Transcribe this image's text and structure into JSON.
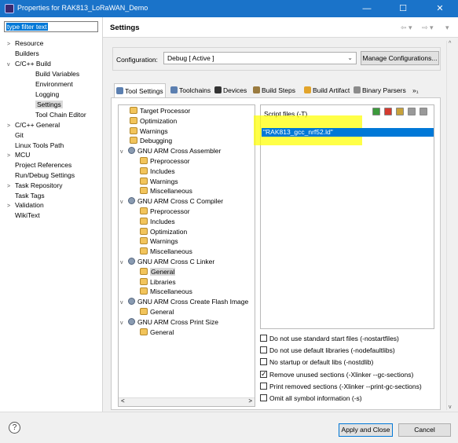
{
  "window": {
    "title": "Properties for RAK813_LoRaWAN_Demo",
    "min": "—",
    "max": "☐",
    "close": "✕"
  },
  "filter": {
    "value": "type filter text"
  },
  "nav_tree": [
    {
      "label": "Resource",
      "twist": ">",
      "depth": 0
    },
    {
      "label": "Builders",
      "twist": "",
      "depth": 0
    },
    {
      "label": "C/C++ Build",
      "twist": "v",
      "depth": 0
    },
    {
      "label": "Build Variables",
      "twist": "",
      "depth": 1
    },
    {
      "label": "Environment",
      "twist": "",
      "depth": 1
    },
    {
      "label": "Logging",
      "twist": "",
      "depth": 1
    },
    {
      "label": "Settings",
      "twist": "",
      "depth": 1,
      "selected": true
    },
    {
      "label": "Tool Chain Editor",
      "twist": "",
      "depth": 1
    },
    {
      "label": "C/C++ General",
      "twist": ">",
      "depth": 0
    },
    {
      "label": "Git",
      "twist": "",
      "depth": 0
    },
    {
      "label": "Linux Tools Path",
      "twist": "",
      "depth": 0
    },
    {
      "label": "MCU",
      "twist": ">",
      "depth": 0
    },
    {
      "label": "Project References",
      "twist": "",
      "depth": 0
    },
    {
      "label": "Run/Debug Settings",
      "twist": "",
      "depth": 0
    },
    {
      "label": "Task Repository",
      "twist": ">",
      "depth": 0
    },
    {
      "label": "Task Tags",
      "twist": "",
      "depth": 0
    },
    {
      "label": "Validation",
      "twist": ">",
      "depth": 0
    },
    {
      "label": "WikiText",
      "twist": "",
      "depth": 0
    }
  ],
  "settings": {
    "title": "Settings",
    "back": "⇦ ▾",
    "fwd": "⇨ ▾",
    "menu": "▾",
    "config_label": "Configuration:",
    "config_value": "Debug  [ Active ]",
    "manage_label": "Manage Configurations..."
  },
  "tabs": [
    {
      "label": "Tool Settings",
      "icon_color": "#5b7fb0",
      "active": true
    },
    {
      "label": "Toolchains",
      "icon_color": "#5b7fb0"
    },
    {
      "label": "Devices",
      "icon_color": "#333333"
    },
    {
      "label": "Build Steps",
      "icon_color": "#9a7b3f"
    },
    {
      "label": "Build Artifact",
      "icon_color": "#e2a42b"
    },
    {
      "label": "Binary Parsers",
      "icon_color": "#8b8b8b"
    },
    {
      "label": "»₁",
      "icon_color": ""
    }
  ],
  "tool_tree": [
    {
      "label": "Target Processor",
      "twist": "",
      "icon": "t",
      "depth": 1
    },
    {
      "label": "Optimization",
      "twist": "",
      "icon": "t",
      "depth": 1
    },
    {
      "label": "Warnings",
      "twist": "",
      "icon": "t",
      "depth": 1
    },
    {
      "label": "Debugging",
      "twist": "",
      "icon": "t",
      "depth": 1
    },
    {
      "label": "GNU ARM Cross Assembler",
      "twist": "v",
      "icon": "g",
      "depth": 0
    },
    {
      "label": "Preprocessor",
      "twist": "",
      "icon": "t",
      "depth": 2
    },
    {
      "label": "Includes",
      "twist": "",
      "icon": "t",
      "depth": 2
    },
    {
      "label": "Warnings",
      "twist": "",
      "icon": "t",
      "depth": 2
    },
    {
      "label": "Miscellaneous",
      "twist": "",
      "icon": "t",
      "depth": 2
    },
    {
      "label": "GNU ARM Cross C Compiler",
      "twist": "v",
      "icon": "g",
      "depth": 0
    },
    {
      "label": "Preprocessor",
      "twist": "",
      "icon": "t",
      "depth": 2
    },
    {
      "label": "Includes",
      "twist": "",
      "icon": "t",
      "depth": 2
    },
    {
      "label": "Optimization",
      "twist": "",
      "icon": "t",
      "depth": 2
    },
    {
      "label": "Warnings",
      "twist": "",
      "icon": "t",
      "depth": 2
    },
    {
      "label": "Miscellaneous",
      "twist": "",
      "icon": "t",
      "depth": 2
    },
    {
      "label": "GNU ARM Cross C Linker",
      "twist": "v",
      "icon": "g",
      "depth": 0
    },
    {
      "label": "General",
      "twist": "",
      "icon": "t",
      "depth": 2,
      "selected": true
    },
    {
      "label": "Libraries",
      "twist": "",
      "icon": "t",
      "depth": 2
    },
    {
      "label": "Miscellaneous",
      "twist": "",
      "icon": "t",
      "depth": 2
    },
    {
      "label": "GNU ARM Cross Create Flash Image",
      "twist": "v",
      "icon": "g",
      "depth": 0
    },
    {
      "label": "General",
      "twist": "",
      "icon": "t",
      "depth": 2
    },
    {
      "label": "GNU ARM Cross Print Size",
      "twist": "v",
      "icon": "g",
      "depth": 0
    },
    {
      "label": "General",
      "twist": "",
      "icon": "t",
      "depth": 2
    }
  ],
  "scroll": {
    "left": "<",
    "right": ">",
    "up": "^",
    "down": "v"
  },
  "script": {
    "label": "Script files (-T)",
    "value": "\"RAK813_gcc_nrf52.ld\"",
    "tool_icons": [
      {
        "name": "add-file-icon",
        "color": "#3c9a3c"
      },
      {
        "name": "delete-file-icon",
        "color": "#d43a2f"
      },
      {
        "name": "edit-file-icon",
        "color": "#c8a23a"
      },
      {
        "name": "move-up-icon",
        "color": "#999999"
      },
      {
        "name": "move-down-icon",
        "color": "#999999"
      }
    ]
  },
  "options": [
    {
      "label": "Do not use standard start files (-nostartfiles)",
      "checked": false
    },
    {
      "label": "Do not use default libraries (-nodefaultlibs)",
      "checked": false
    },
    {
      "label": "No startup or default libs (-nostdlib)",
      "checked": false
    },
    {
      "label": "Remove unused sections (-Xlinker --gc-sections)",
      "checked": true
    },
    {
      "label": "Print removed sections (-Xlinker --print-gc-sections)",
      "checked": false
    },
    {
      "label": "Omit all symbol information (-s)",
      "checked": false
    }
  ],
  "footer": {
    "help": "?",
    "apply_label": "Apply and Close",
    "cancel_label": "Cancel"
  }
}
